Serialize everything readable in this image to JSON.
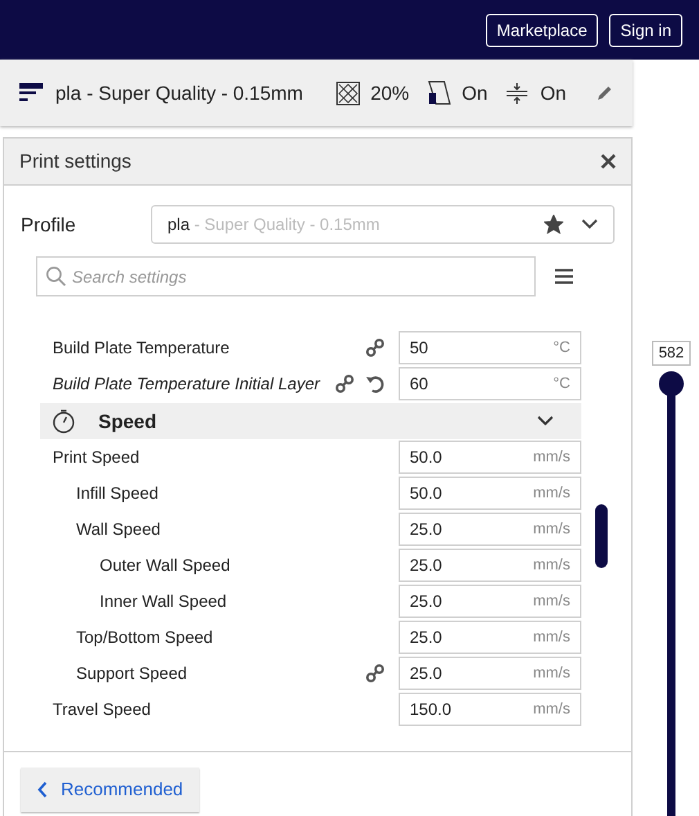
{
  "top_bar": {
    "buttons": [
      "Marketplace",
      "Sign in"
    ]
  },
  "print_setup": {
    "profile": "pla - Super Quality - 0.15mm",
    "infill": "20%",
    "support": "On",
    "adhesion": "On"
  },
  "panel": {
    "title": "Print settings",
    "profile": {
      "label": "Profile",
      "name": "pla",
      "detail": " - Super Quality - 0.15mm",
      "favorite": true
    },
    "search": {
      "placeholder": "Search settings"
    },
    "settings": [
      {
        "kind": "setting",
        "label": "Build Plate Temperature",
        "modified": false,
        "linked": true,
        "resettable": false,
        "value": "50",
        "unit": "°C"
      },
      {
        "kind": "setting",
        "label": "Build Plate Temperature Initial Layer",
        "modified": true,
        "linked": true,
        "resettable": true,
        "value": "60",
        "unit": "°C"
      },
      {
        "kind": "category",
        "label": "Speed",
        "expanded": true
      },
      {
        "kind": "setting",
        "label": "Print Speed",
        "modified": false,
        "linked": false,
        "resettable": false,
        "value": "50.0",
        "unit": "mm/s",
        "children": [
          {
            "kind": "setting",
            "label": "Infill Speed",
            "modified": false,
            "linked": false,
            "resettable": false,
            "value": "50.0",
            "unit": "mm/s"
          },
          {
            "kind": "setting",
            "label": "Wall Speed",
            "modified": false,
            "linked": false,
            "resettable": false,
            "value": "25.0",
            "unit": "mm/s",
            "children": [
              {
                "kind": "setting",
                "label": "Outer Wall Speed",
                "modified": false,
                "linked": false,
                "resettable": false,
                "value": "25.0",
                "unit": "mm/s"
              },
              {
                "kind": "setting",
                "label": "Inner Wall Speed",
                "modified": false,
                "linked": false,
                "resettable": false,
                "value": "25.0",
                "unit": "mm/s"
              }
            ]
          },
          {
            "kind": "setting",
            "label": "Top/Bottom Speed",
            "modified": false,
            "linked": false,
            "resettable": false,
            "value": "25.0",
            "unit": "mm/s"
          },
          {
            "kind": "setting",
            "label": "Support Speed",
            "modified": false,
            "linked": true,
            "resettable": false,
            "value": "25.0",
            "unit": "mm/s"
          }
        ]
      },
      {
        "kind": "setting",
        "label": "Travel Speed",
        "modified": false,
        "linked": false,
        "resettable": false,
        "value": "150.0",
        "unit": "mm/s"
      }
    ],
    "back_button": "Recommended"
  },
  "layer_slider": {
    "value": "582",
    "level": 1
  }
}
